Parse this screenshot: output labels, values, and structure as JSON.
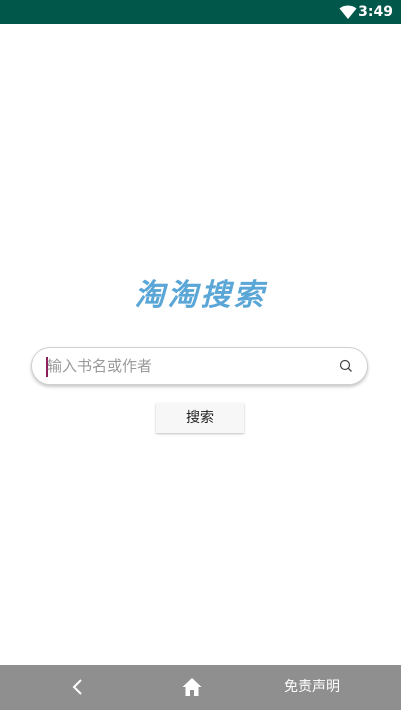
{
  "status_bar": {
    "time": "3:49",
    "icons": [
      "wifi-icon"
    ],
    "background_color": "#02574b"
  },
  "logo": {
    "text": "淘淘搜索",
    "color": "#5aa6d6"
  },
  "search": {
    "placeholder": "输入书名或作者",
    "value": "",
    "icon": "search-icon"
  },
  "search_button": {
    "label": "搜索"
  },
  "bottom_nav": {
    "back_icon": "chevron-left-icon",
    "home_icon": "home-icon",
    "disclaimer_label": "免责声明",
    "background_color": "#8f8f8f"
  }
}
